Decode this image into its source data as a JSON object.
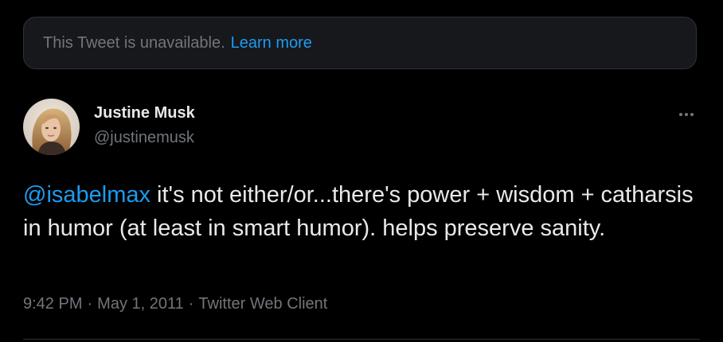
{
  "notice": {
    "text": "This Tweet is unavailable.",
    "link_label": "Learn more"
  },
  "author": {
    "name": "Justine Musk",
    "handle": "@justinemusk",
    "avatar": "avatar-photo"
  },
  "menu": {
    "icon": "more-dots-icon"
  },
  "tweet": {
    "mention": "@isabelmax",
    "body": " it's not either/or...there's power + wisdom + catharsis in humor  (at least in smart humor). helps preserve sanity."
  },
  "meta": {
    "time": "9:42 PM",
    "separator": "·",
    "date": "May 1, 2011",
    "source": "Twitter Web Client"
  },
  "colors": {
    "background": "#000000",
    "accent": "#1d9bf0",
    "text_primary": "#e7e9ea",
    "text_secondary": "#71767b",
    "notice_background": "#16181c"
  }
}
